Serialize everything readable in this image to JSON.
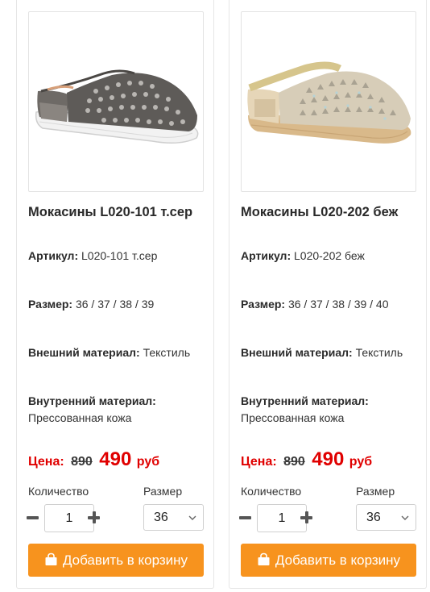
{
  "colors": {
    "price_red": "#e00000",
    "button_orange": "#f7931e"
  },
  "products": [
    {
      "image_icon": "shoe-image",
      "title": "Мокасины L020-101 т.сер",
      "article_label": "Артикул:",
      "article_value": "L020-101 т.сер",
      "size_label": "Размер:",
      "sizes": "36 / 37 / 38 / 39",
      "outer_label": "Внешний материал:",
      "outer_value": "Текстиль",
      "inner_label": "Внутренний материал:",
      "inner_value": "Прессованная кожа",
      "price_label": "Цена:",
      "old_price": "890",
      "new_price": "490",
      "currency": "руб",
      "qty_label": "Количество",
      "qty_value": "1",
      "size_select_label": "Размер",
      "size_selected": "36",
      "add_button": "Добавить в корзину"
    },
    {
      "image_icon": "shoe-image",
      "title": "Мокасины L020-202 беж",
      "article_label": "Артикул:",
      "article_value": "L020-202 беж",
      "size_label": "Размер:",
      "sizes": "36 / 37 / 38 / 39 / 40",
      "outer_label": "Внешний материал:",
      "outer_value": "Текстиль",
      "inner_label": "Внутренний материал:",
      "inner_value": "Прессованная кожа",
      "price_label": "Цена:",
      "old_price": "890",
      "new_price": "490",
      "currency": "руб",
      "qty_label": "Количество",
      "qty_value": "1",
      "size_select_label": "Размер",
      "size_selected": "36",
      "add_button": "Добавить в корзину"
    }
  ]
}
